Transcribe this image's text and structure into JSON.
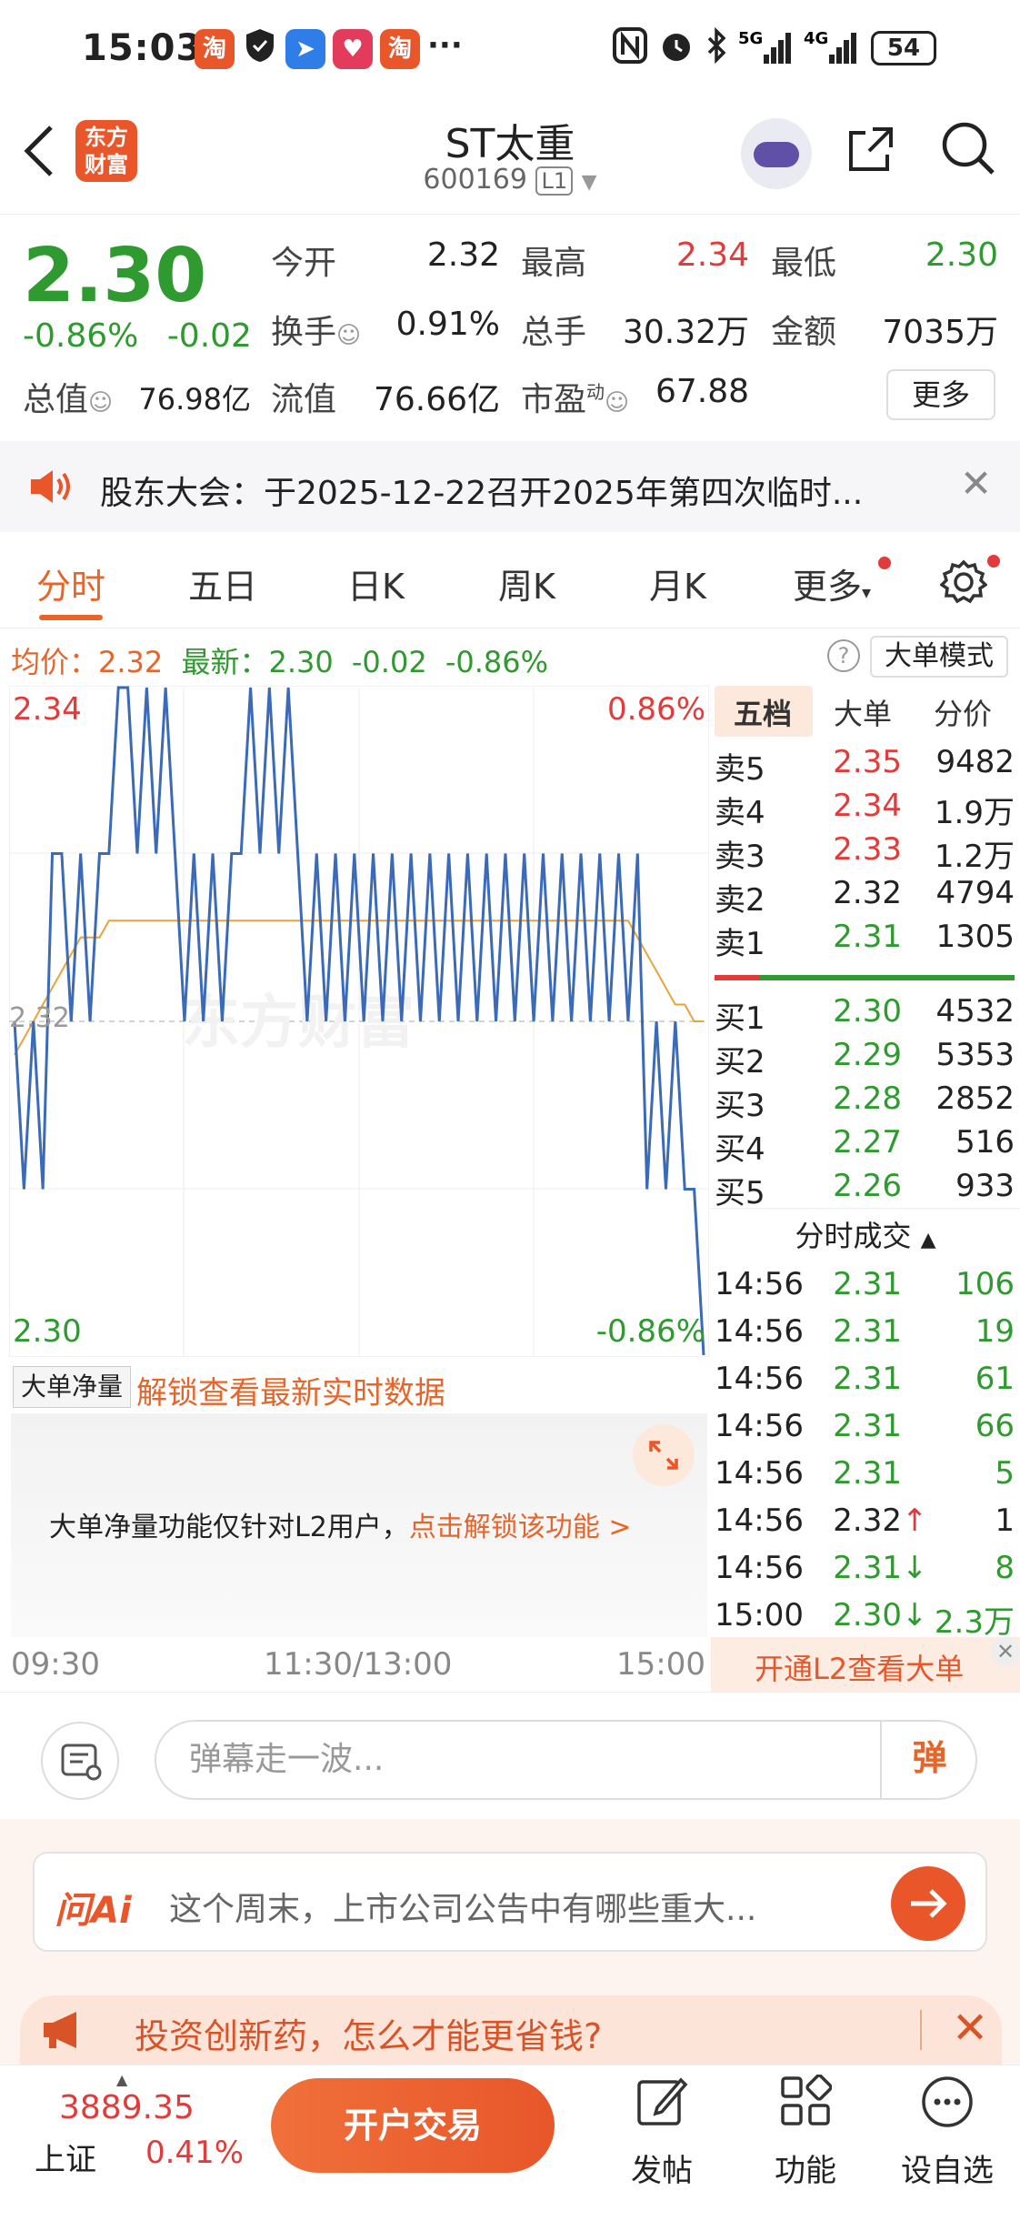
{
  "status_bar": {
    "time": "15:03",
    "battery": "54",
    "apps": [
      "淘",
      "淘",
      "淘"
    ],
    "icons": [
      "shield-icon",
      "send-icon",
      "nfc-icon",
      "alarm-icon",
      "bluetooth-icon",
      "signal-5g-icon",
      "signal-4g-icon",
      "battery-icon"
    ]
  },
  "header": {
    "logo_line1": "东方",
    "logo_line2": "财富",
    "title": "ST太重",
    "code": "600169",
    "level": "L1"
  },
  "quote": {
    "price": "2.30",
    "change_pct": "-0.86%",
    "change": "-0.02",
    "fields": [
      {
        "label": "今开",
        "value": "2.32",
        "color": "#222222"
      },
      {
        "label": "最高",
        "value": "2.34",
        "color": "#e23b3b"
      },
      {
        "label": "最低",
        "value": "2.30",
        "color": "#2f9a2f"
      },
      {
        "label": "换手",
        "value": "0.91%",
        "color": "#222222"
      },
      {
        "label": "总手",
        "value": "30.32万",
        "color": "#222222"
      },
      {
        "label": "金额",
        "value": "7035万",
        "color": "#222222"
      },
      {
        "label": "总值",
        "value": "76.98亿",
        "color": "#222222"
      },
      {
        "label": "流值",
        "value": "76.66亿",
        "color": "#222222"
      },
      {
        "label": "市盈",
        "value": "67.88",
        "color": "#222222"
      }
    ],
    "pe_superscript": "动",
    "more_label": "更多"
  },
  "notice": {
    "text": "股东大会：于2025-12-22召开2025年第四次临时..."
  },
  "tabs": [
    "分时",
    "五日",
    "日K",
    "周K",
    "月K",
    "更多"
  ],
  "info_line": {
    "avg_label": "均价：",
    "avg_value": "2.32",
    "latest_label": "最新：",
    "latest_value": "2.30",
    "latest_change": "-0.02",
    "latest_pct": "-0.86%",
    "big_order_mode": "大单模式"
  },
  "chart_data": {
    "type": "line",
    "y_labels": {
      "top": "2.34",
      "mid": "2.32",
      "bottom": "2.30",
      "top_pct": "0.86%",
      "bottom_pct": "-0.86%"
    },
    "ylim": [
      2.3,
      2.34
    ],
    "x_ticks": [
      "09:30",
      "11:30/13:00",
      "15:00"
    ],
    "watermark": "东方财富",
    "price_series": [
      2.32,
      2.31,
      2.32,
      2.31,
      2.33,
      2.33,
      2.32,
      2.33,
      2.32,
      2.33,
      2.33,
      2.34,
      2.34,
      2.33,
      2.34,
      2.33,
      2.34,
      2.33,
      2.32,
      2.33,
      2.32,
      2.33,
      2.32,
      2.33,
      2.33,
      2.34,
      2.33,
      2.34,
      2.33,
      2.34,
      2.33,
      2.32,
      2.33,
      2.32,
      2.33,
      2.32,
      2.33,
      2.32,
      2.33,
      2.32,
      2.33,
      2.32,
      2.33,
      2.32,
      2.33,
      2.32,
      2.33,
      2.32,
      2.33,
      2.32,
      2.33,
      2.32,
      2.33,
      2.32,
      2.33,
      2.32,
      2.33,
      2.32,
      2.33,
      2.32,
      2.33,
      2.32,
      2.33,
      2.32,
      2.33,
      2.32,
      2.33,
      2.31,
      2.32,
      2.31,
      2.32,
      2.31,
      2.31,
      2.3
    ],
    "avg_series": [
      2.318,
      2.319,
      2.32,
      2.321,
      2.322,
      2.323,
      2.324,
      2.325,
      2.325,
      2.325,
      2.326,
      2.326,
      2.326,
      2.326,
      2.326,
      2.326,
      2.326,
      2.326,
      2.326,
      2.326,
      2.326,
      2.326,
      2.326,
      2.326,
      2.326,
      2.326,
      2.326,
      2.326,
      2.326,
      2.326,
      2.326,
      2.326,
      2.326,
      2.326,
      2.326,
      2.326,
      2.326,
      2.326,
      2.326,
      2.326,
      2.326,
      2.326,
      2.326,
      2.326,
      2.326,
      2.326,
      2.326,
      2.326,
      2.326,
      2.326,
      2.326,
      2.326,
      2.326,
      2.326,
      2.326,
      2.326,
      2.326,
      2.326,
      2.326,
      2.326,
      2.326,
      2.326,
      2.326,
      2.326,
      2.326,
      2.326,
      2.325,
      2.324,
      2.323,
      2.322,
      2.321,
      2.321,
      2.32,
      2.32
    ]
  },
  "right_panel": {
    "tabs": [
      "五档",
      "大单",
      "分价"
    ],
    "sell": [
      {
        "label": "卖5",
        "price": "2.35",
        "vol": "9482",
        "color": "#e23b3b"
      },
      {
        "label": "卖4",
        "price": "2.34",
        "vol": "1.9万",
        "color": "#e23b3b"
      },
      {
        "label": "卖3",
        "price": "2.33",
        "vol": "1.2万",
        "color": "#e23b3b"
      },
      {
        "label": "卖2",
        "price": "2.32",
        "vol": "4794",
        "color": "#222222"
      },
      {
        "label": "卖1",
        "price": "2.31",
        "vol": "1305",
        "color": "#2f9a2f"
      }
    ],
    "buy": [
      {
        "label": "买1",
        "price": "2.30",
        "vol": "4532",
        "color": "#2f9a2f"
      },
      {
        "label": "买2",
        "price": "2.29",
        "vol": "5353",
        "color": "#2f9a2f"
      },
      {
        "label": "买3",
        "price": "2.28",
        "vol": "2852",
        "color": "#2f9a2f"
      },
      {
        "label": "买4",
        "price": "2.27",
        "vol": "516",
        "color": "#2f9a2f"
      },
      {
        "label": "买5",
        "price": "2.26",
        "vol": "933",
        "color": "#2f9a2f"
      }
    ],
    "ticks_title": "分时成交",
    "ticks": [
      {
        "time": "14:56",
        "price": "2.31",
        "vol": "106",
        "color": "#2f9a2f",
        "arrow": ""
      },
      {
        "time": "14:56",
        "price": "2.31",
        "vol": "19",
        "color": "#2f9a2f",
        "arrow": ""
      },
      {
        "time": "14:56",
        "price": "2.31",
        "vol": "61",
        "color": "#2f9a2f",
        "arrow": ""
      },
      {
        "time": "14:56",
        "price": "2.31",
        "vol": "66",
        "color": "#2f9a2f",
        "arrow": ""
      },
      {
        "time": "14:56",
        "price": "2.31",
        "vol": "5",
        "color": "#2f9a2f",
        "arrow": ""
      },
      {
        "time": "14:56",
        "price": "2.32",
        "vol": "1",
        "color": "#222222",
        "arrow": "↑"
      },
      {
        "time": "14:56",
        "price": "2.31",
        "vol": "8",
        "color": "#2f9a2f",
        "arrow": "↓"
      },
      {
        "time": "15:00",
        "price": "2.30",
        "vol": "2.3万",
        "color": "#2f9a2f",
        "arrow": "↓"
      }
    ],
    "l2_label": "开通L2查看大单"
  },
  "volume": {
    "select_label": "大单净量",
    "unlock_text": "解锁查看最新实时数据",
    "message": "大单净量功能仅针对L2用户，",
    "message_link": "点击解锁该功能 >"
  },
  "danmaku": {
    "placeholder": "弹幕走一波...",
    "button": "弹"
  },
  "ask_ai": {
    "logo": "问Ai",
    "text": "这个周末，上市公司公告中有哪些重大..."
  },
  "ad": {
    "text": "投资创新药，怎么才能更省钱?"
  },
  "bottom_bar": {
    "index_value": "3889.35",
    "index_name": "上证",
    "index_pct": "0.41%",
    "trade_button": "开户交易",
    "buttons": [
      "发帖",
      "功能",
      "设自选"
    ]
  }
}
